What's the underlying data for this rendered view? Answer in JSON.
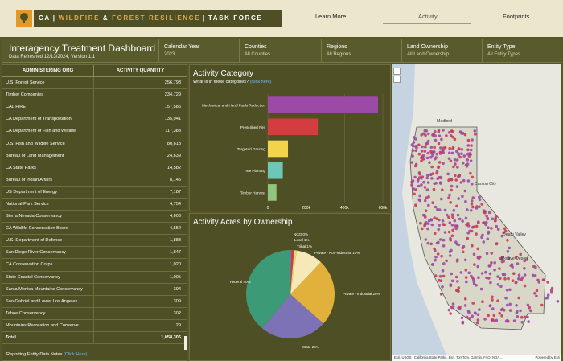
{
  "nav": {
    "brand": [
      "CA",
      "WILDFIRE",
      "&",
      "FOREST RESILIENCE",
      "TASK FORCE"
    ],
    "links": [
      "Learn More",
      "Activity",
      "Footprints"
    ]
  },
  "header": {
    "title": "Interagency Treatment Dashboard",
    "subtitle": "Data Refreshed 12/13/2024, Version 1.1",
    "filters": [
      {
        "label": "Calendar Year",
        "value": "2023"
      },
      {
        "label": "Counties",
        "value": "All Counties"
      },
      {
        "label": "Regions",
        "value": "All Regions"
      },
      {
        "label": "Land Ownership",
        "value": "All Land Ownership"
      },
      {
        "label": "Entity Type",
        "value": "All Entity Types"
      }
    ]
  },
  "table": {
    "headers": [
      "ADMINISTERING ORG",
      "ACTIVITY QUANTITY"
    ],
    "rows": [
      [
        "U.S. Forest Service",
        "256,798"
      ],
      [
        "Timber Companies",
        "234,729"
      ],
      [
        "CAL FIRE",
        "157,585"
      ],
      [
        "CA Department of Transportation",
        "135,941"
      ],
      [
        "CA Department of Fish and Wildlife",
        "117,383"
      ],
      [
        "U.S. Fish and Wildlife Service",
        "80,618"
      ],
      [
        "Bureau of Land Management",
        "24,639"
      ],
      [
        "CA State Parks",
        "14,582"
      ],
      [
        "Bureau of Indian Affairs",
        "8,145"
      ],
      [
        "US Department of Energy",
        "7,187"
      ],
      [
        "National Park Service",
        "4,754"
      ],
      [
        "Sierra Nevada Conservancy",
        "4,603"
      ],
      [
        "CA Wildlife Conservation Board",
        "4,552"
      ],
      [
        "U.S. Department of Defense",
        "1,883"
      ],
      [
        "San Diego River Conservancy",
        "1,847"
      ],
      [
        "CA Conservation Corps",
        "1,020"
      ],
      [
        "State Coastal Conservancy",
        "1,005"
      ],
      [
        "Santa Monica Mountains Conservancy",
        "394"
      ],
      [
        "San Gabriel and Lower Los Angeles ...",
        "309"
      ],
      [
        "Tahoe Conservancy",
        "302"
      ],
      [
        "Mountains Recreation and Conserve...",
        "29"
      ]
    ],
    "total_label": "Total",
    "total_value": "1,058,306",
    "footnote": "Reporting Entity Data Notes",
    "footnote_link": "(Click Here)"
  },
  "chart_data": [
    {
      "type": "bar",
      "orientation": "horizontal",
      "title": "Activity Category",
      "subtitle": "What is in these categories?",
      "subtitle_link": "(click here)",
      "categories": [
        "Mechanical and Hand Fuels Reduction",
        "Prescribed Fire",
        "Targeted Grazing",
        "Tree Planting",
        "Timber Harvest"
      ],
      "values": [
        575000,
        265000,
        105000,
        78000,
        45000
      ],
      "colors": [
        "#9b4aa6",
        "#d43c40",
        "#f3d34a",
        "#6cc7b8",
        "#93c47d"
      ],
      "xticks": [
        "0",
        "200k",
        "400k",
        "600k"
      ],
      "xlim": [
        0,
        600000
      ],
      "grid": true
    },
    {
      "type": "pie",
      "title": "Activity Acres by Ownership",
      "labels": [
        "NGO 0%",
        "Local 1%",
        "Tribal 1%",
        "Private - Non-Industrial 10%",
        "Private - Industrial 25%",
        "State 25%",
        "Federal 40%"
      ],
      "values": [
        0.4,
        1,
        1,
        10,
        25,
        25,
        40
      ],
      "colors": [
        "#7f6fb8",
        "#d43c40",
        "#e8e06a",
        "#f7e8b8",
        "#e1b13c",
        "#7e72b6",
        "#3d9a77"
      ]
    }
  ],
  "map": {
    "labels": [
      "Medford",
      "Carson City",
      "Death Valley",
      "Mojave Desert"
    ],
    "attribution": "Esri, USGS | California State Parks, Esri, TomTom, Garmin, FAO, NOA...",
    "powered": "Powered by Esri"
  }
}
